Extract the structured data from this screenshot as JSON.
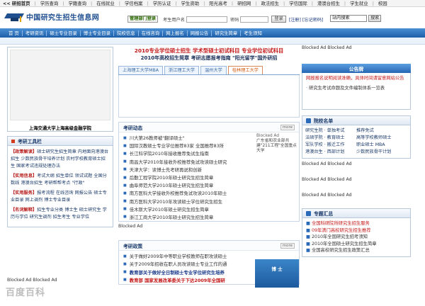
{
  "topnav": [
    "<< 研招首页",
    "学历查询",
    "学籍查询",
    "在线就业",
    "学信档案",
    "学历认证",
    "学生资助",
    "阳光高考",
    "研招网",
    "政法招生",
    "学信国际",
    "港澳台招生",
    "学生就业",
    "校园"
  ],
  "header": {
    "logo_title": "中国研究生招生信息网",
    "manager_login": "管理部门登录",
    "user_label": "考生用户名",
    "pw_label": "密码",
    "login_btn": "登录",
    "register_link": "[注册]",
    "forgot_link": "[忘记密码]",
    "search_value": "站内搜索",
    "search_btn": "搜索"
  },
  "mainnav": [
    "首  页",
    "考研资讯",
    "硕士专业目录",
    "博士专业目录",
    "院校信息",
    "在线咨询",
    "网上报名",
    "网报公告",
    "研究生简章",
    "考生须知"
  ],
  "left": {
    "ad_caption": "上海交通大学上海高级金融学院",
    "tools_title": "考研工具栏",
    "tools": [
      {
        "tag": "【政策解读】",
        "text": "硕士研究生招生简章 内地面向港澳台招生 少数民族骨干培养计划 农村学校教育硕士招生 国家考试违规处理办法"
      },
      {
        "tag": "【实用信息】",
        "text": "考试大纲 招生单位 领试试题 全国分数线 港澳台招生 考研帮帮考点 \"行政\""
      },
      {
        "tag": "【实用服务】",
        "text": "报考流程 在线咨询 网报公告 硕士专业目录 网上调剂 博士专业目录"
      },
      {
        "tag": "【名词解释】",
        "text": "招生专业分类 博士生 硕士研究生 学历与学位 研究生调剂 招生考生 专业学位"
      }
    ],
    "blocked": "Blocked Ad Blocked Ad",
    "watermark": "百度百科"
  },
  "center": {
    "headline1": "2010专业学位硕士招生  学术型硕士初试科目  专业学位初试科目",
    "headline2": "2010年高校招生简章  考研志愿报考指南  \"阳光留学\"国外研招",
    "tabs": [
      "上海理工大学MBA",
      "浙江理工大学",
      "温州大学",
      "桂林理工大学"
    ],
    "news_title": "考研动态",
    "more": "more",
    "news": [
      "川大第26教师被\"翻译硕士\"",
      "国际汉教硕士专业学位推荐83家 全国推荐83所",
      "长江科学院2010年接收推荐免试生指南",
      "南昌大学2010年接收外校推荐免试攻读硕士研究",
      "天津大学：读博士先考研再说和创新",
      "后勤工程学院2010年硕士研究生招生简章",
      "曲阜师范大学2010年硕士研究生招生简章",
      "南方医科大学接收外校推荐免试攻读2010年硕士",
      "南方医科大学2010年攻读硕士学位研究生招生",
      "佳木斯大学2010年硕士研究生招生简章",
      "浙江工商大学2010年硕士研究生招生简章"
    ],
    "news_ad": "Blocked Ad",
    "news_ad_text": "广东省和农业部共建\"211工程\"全国重点大学",
    "blocked_mid": "Blocked Ad",
    "policy_title": "考研政策",
    "policy": [
      "关于做好2009年中等职业学校教师在职攻读硕士",
      "关于2009年招收在职人员攻读硕士专业工作的通",
      "教育部关于做好全日制硕士专业学位研究生培养",
      "教育部 国家发展改革委关于下达2009年全国研"
    ],
    "policy_ad": "博 士"
  },
  "right": {
    "blocked_top": "Blocked Ad Blocked Ad",
    "notice_title": "公告牌",
    "notices": [
      {
        "text": "网报报名说明阅读准确，具体时间请留意网站公告",
        "style": "red"
      },
      {
        "text": "研究生考试命题及文件编制体系一览表",
        "style": "dark"
      }
    ],
    "schools_title": "院校名单",
    "schools": [
      [
        "研究生院",
        "单独考试",
        "推荐免试"
      ],
      [
        "法硕学院",
        "教育硕士",
        "高等学校教师硕士"
      ],
      [
        "军队学校",
        "搬迁工作",
        "职业硕士 MBA"
      ],
      [
        "港澳台生",
        "西部计划",
        "少数民族骨干计划"
      ]
    ],
    "blocked_mid": "Blocked Ad Blocked Ad",
    "topics_title": "专题汇总",
    "topics": [
      {
        "text": "全国科研院所研究生招生服务",
        "style": "red"
      },
      {
        "text": "09年清门高校研究生招生推荐",
        "style": "red"
      },
      {
        "text": "2010年全国研究生招考须知",
        "style": "dark"
      },
      {
        "text": "2010年全国硕士研究生招生简章",
        "style": "dark"
      },
      {
        "text": "全国高校研究生招生政策汇总",
        "style": "dark"
      }
    ]
  }
}
